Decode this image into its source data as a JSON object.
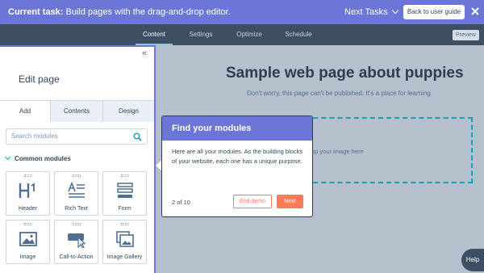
{
  "taskbar": {
    "label": "Current task:",
    "task": "Build pages with the drag-and-drop editor.",
    "next_tasks": "Next Tasks",
    "back_button": "Back to user guide"
  },
  "editor_tabs": [
    "Content",
    "Settings",
    "Optimize",
    "Schedule"
  ],
  "preview_button": "Preview",
  "panel": {
    "collapse_icon": "double-chevron-left-icon",
    "title": "Edit page",
    "tabs": [
      "Add",
      "Contents",
      "Design"
    ],
    "search_placeholder": "Search modules",
    "section_title": "Common modules",
    "modules": [
      {
        "label": "Header",
        "icon": "header-icon"
      },
      {
        "label": "Rich Text",
        "icon": "rich-text-icon"
      },
      {
        "label": "Form",
        "icon": "form-icon"
      },
      {
        "label": "Image",
        "icon": "image-icon"
      },
      {
        "label": "Call-to-Action",
        "icon": "cta-icon"
      },
      {
        "label": "Image Gallery",
        "icon": "image-gallery-icon"
      }
    ]
  },
  "canvas": {
    "heading": "Sample web page about puppies",
    "subheading": "Don't worry, this page can't be published. It's a place for learning.",
    "dropzone_text": "op your image here"
  },
  "popover": {
    "title": "Find your modules",
    "body": "Here are all your modules. As the building blocks of your website, each one has a unique purpose.",
    "progress": "2 of 10",
    "end_button": "End demo",
    "next_button": "Next"
  },
  "help_button": "Help",
  "colors": {
    "accent": "#6b76d6",
    "cta": "#ff7a59",
    "teal": "#00a4bd",
    "dark_nav": "#3e4f63"
  }
}
